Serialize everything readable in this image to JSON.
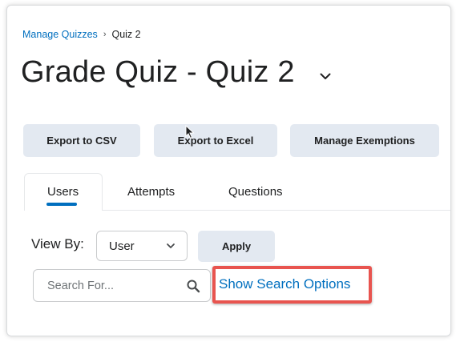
{
  "breadcrumb": {
    "parent": "Manage Quizzes",
    "separator": "›",
    "current": "Quiz 2"
  },
  "header": {
    "title": "Grade Quiz - Quiz 2",
    "menu_icon": "chevron-down-icon"
  },
  "toolbar": {
    "export_csv_label": "Export to CSV",
    "export_excel_label": "Export to Excel",
    "manage_exemptions_label": "Manage Exemptions"
  },
  "tabs": [
    {
      "label": "Users",
      "selected": true
    },
    {
      "label": "Attempts",
      "selected": false
    },
    {
      "label": "Questions",
      "selected": false
    }
  ],
  "filters": {
    "view_by_label": "View By:",
    "view_by_selected": "User",
    "apply_label": "Apply",
    "search_placeholder": "Search For...",
    "search_value": "",
    "show_search_options_label": "Show Search Options"
  },
  "colors": {
    "link": "#006fbf",
    "button_bg": "#e3e9f1",
    "tab_indicator": "#006fbf",
    "highlight": "#e8544f"
  }
}
